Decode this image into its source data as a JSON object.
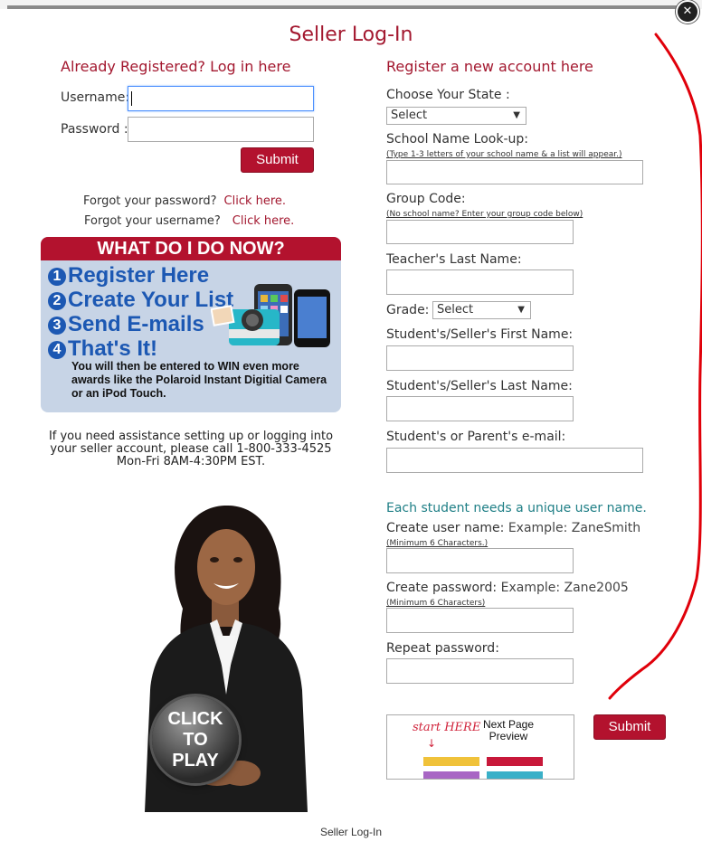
{
  "modal": {
    "title": "Seller Log-In",
    "close_glyph": "✕"
  },
  "login": {
    "heading": "Already Registered? Log in here",
    "username_label": "Username:",
    "password_label": "Password :",
    "submit_label": "Submit",
    "forgot_password_text": "Forgot your password?",
    "forgot_password_link": "Click here.",
    "forgot_username_text": "Forgot your username?",
    "forgot_username_link": "Click here."
  },
  "promo": {
    "heading": "WHAT DO I DO NOW?",
    "steps": [
      {
        "num": "1",
        "text": "Register Here"
      },
      {
        "num": "2",
        "text": "Create Your List"
      },
      {
        "num": "3",
        "text": "Send E-mails"
      },
      {
        "num": "4",
        "text": "That's It!"
      }
    ],
    "desc": "You will then be entered to WIN even more awards like the Polaroid Instant Digitial Camera or an iPod Touch."
  },
  "assist_text": "If you need assistance setting up or logging into your seller account, please call 1-800-333-4525 Mon-Fri 8AM-4:30PM EST.",
  "video": {
    "button_line1": "CLICK",
    "button_line2": "TO",
    "button_line3": "PLAY"
  },
  "register": {
    "heading": "Register a new account here",
    "state_label": "Choose Your State :",
    "state_value": "Select",
    "school_label": "School Name Look-up:",
    "school_note": "(Type 1-3 letters of your school name & a list will appear.)",
    "group_label": "Group Code:",
    "group_note": "(No school name? Enter your group code below)",
    "teacher_label": "Teacher's Last Name:",
    "grade_label": "Grade:",
    "grade_value": "Select",
    "first_name_label": "Student's/Seller's First Name:",
    "last_name_label": "Student's/Seller's Last Name:",
    "email_label": "Student's or Parent's e-mail:",
    "unique_heading": "Each student needs a unique user name.",
    "username_label": "Create user name:",
    "username_example": "Example: ZaneSmith",
    "username_note": "(Minimum 6 Characters.)",
    "password_label": "Create password:",
    "password_example": "Example: Zane2005",
    "password_note": "(Minimum 6 Characters)",
    "repeat_label": "Repeat password:",
    "submit_label": "Submit",
    "preview_handwritten": "start HERE",
    "preview_title": "Next Page Preview"
  },
  "footer_text": "Seller Log-In",
  "colors": {
    "brand_red": "#a3182f",
    "teal": "#1f7f86",
    "promo_blue": "#1c58b3",
    "annotation_red": "#e0000a"
  }
}
